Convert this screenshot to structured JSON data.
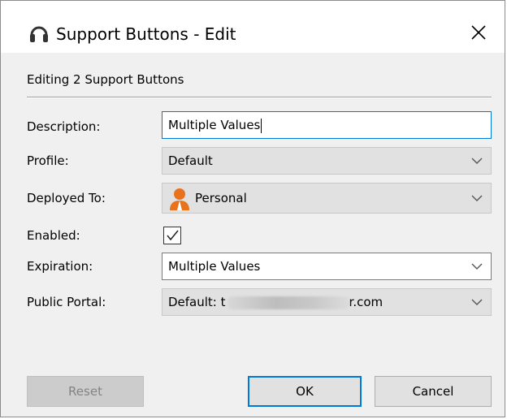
{
  "window": {
    "title": "Support Buttons - Edit",
    "icon": "headset-icon"
  },
  "header": {
    "label": "Editing 2 Support Buttons"
  },
  "fields": {
    "description": {
      "label": "Description:",
      "value": "Multiple Values"
    },
    "profile": {
      "label": "Profile:",
      "value": "Default"
    },
    "deployed_to": {
      "label": "Deployed To:",
      "value": "Personal",
      "icon": "person-icon"
    },
    "enabled": {
      "label": "Enabled:",
      "checked": true
    },
    "expiration": {
      "label": "Expiration:",
      "value": "Multiple Values"
    },
    "public_portal": {
      "label": "Public Portal:",
      "value_prefix": "Default: ",
      "value_visible_start": "t",
      "value_suffix": "r.com"
    }
  },
  "buttons": {
    "reset": "Reset",
    "ok": "OK",
    "cancel": "Cancel"
  },
  "colors": {
    "accent": "#0078d7",
    "person_icon": "#e8731c"
  }
}
